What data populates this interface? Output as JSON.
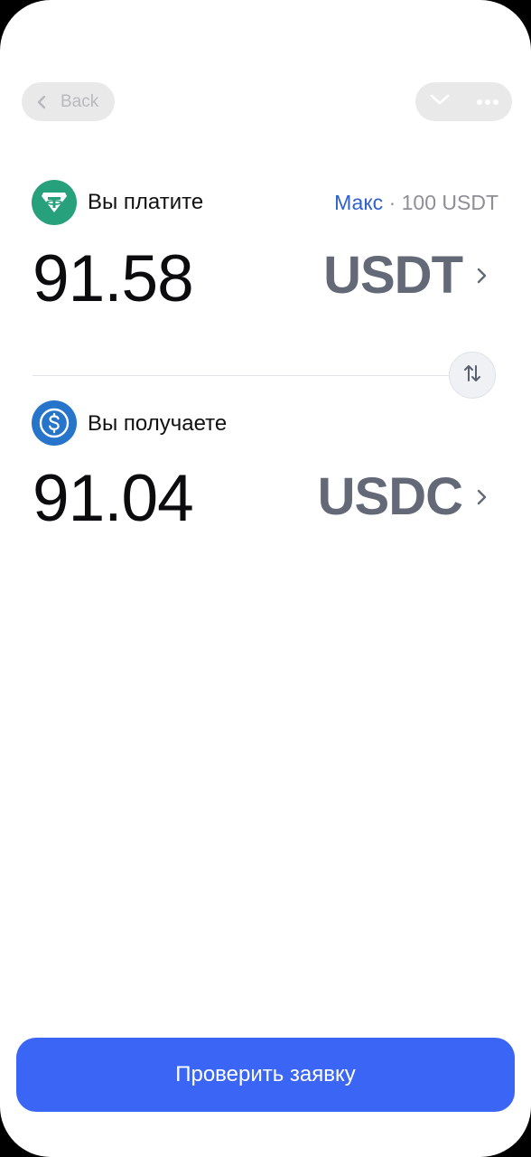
{
  "nav": {
    "back_label": "Back"
  },
  "pay": {
    "label": "Вы платите",
    "max_label": "Макс",
    "max_separator": "·",
    "max_value": "100 USDT",
    "amount": "91.58",
    "currency": "USDT",
    "icon": "tether-icon",
    "icon_color": "#26a17b"
  },
  "receive": {
    "label": "Вы получаете",
    "amount": "91.04",
    "currency": "USDC",
    "icon": "usdc-icon",
    "icon_color": "#2775ca"
  },
  "submit": {
    "label": "Проверить заявку"
  },
  "colors": {
    "accent": "#3b66f5",
    "link": "#2f5fd0",
    "currency_text": "#646977"
  }
}
